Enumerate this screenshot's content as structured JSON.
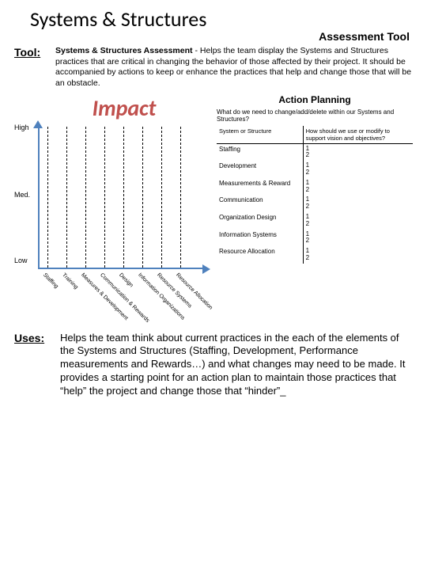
{
  "title": "Systems & Structures",
  "subtitle": "Assessment Tool",
  "tool_label": "Tool:",
  "tool_desc_bold": "Systems & Structures Assessment",
  "tool_desc_rest": " - Helps the team display the Systems and Structures practices that are critical in changing the behavior of those affected by their project. It should be accompanied by actions to keep or enhance the practices that help and change those that will be an obstacle.",
  "impact": "Impact",
  "ylabels": {
    "high": "High",
    "med": "Med.",
    "low": "Low"
  },
  "xlabels": [
    "Staffing",
    "Training",
    "Measures & Development",
    "Communication & Rewards",
    "Design",
    "Information Organizations",
    "Resource Systems",
    "Resource Allocation"
  ],
  "action": {
    "title": "Action Planning",
    "question": "What do we need to change/add/delete within our Systems and Structures?",
    "col1": "System or Structure",
    "col2": "How should we use or modify to support vision and objectives?",
    "rows": [
      "Staffing",
      "Development",
      "Measurements & Reward",
      "Communication",
      "Organization Design",
      "Information Systems",
      "Resource Allocation"
    ],
    "num1": "1",
    "num2": "2"
  },
  "uses_label": "Uses:",
  "uses_text": "Helps the team think about current practices in the each of the elements of the Systems and Structures (Staffing, Development, Performance measurements and Rewards…) and what changes may need to be made. It provides a starting point for an action plan to maintain those practices that “help” the project and change those that “hinder”_",
  "chart_data": {
    "type": "bar",
    "note": "Chart axes only — no data series drawn in source image; dashed vertical guides at each category.",
    "categories": [
      "Staffing",
      "Training",
      "Measures & Development",
      "Communication & Rewards",
      "Design",
      "Information Organizations",
      "Resource Systems",
      "Resource Allocation"
    ],
    "ylabel": "Impact",
    "yticks": [
      "Low",
      "Med.",
      "High"
    ],
    "values": null
  }
}
